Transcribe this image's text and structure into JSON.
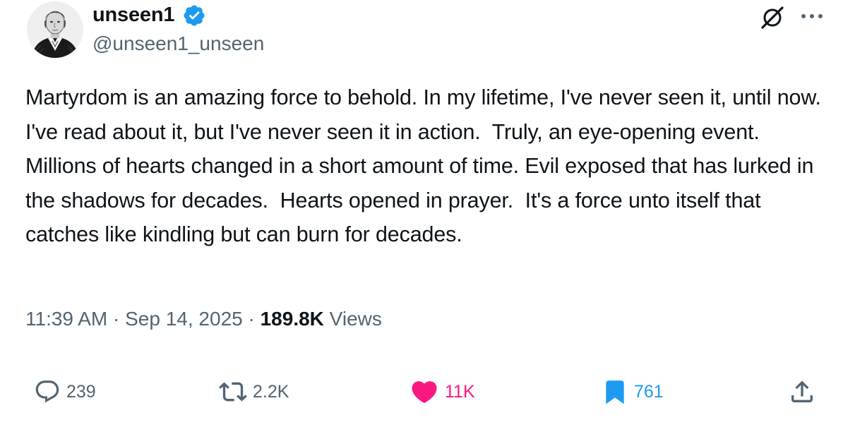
{
  "author": {
    "display_name": "unseen1",
    "handle": "@unseen1_unseen",
    "verified": true,
    "verified_color": "#1d9bf0",
    "avatar_icon": "portrait-engraving"
  },
  "header_actions": {
    "grok_icon": "grok-icon",
    "more_icon": "more-dots-icon"
  },
  "tweet": {
    "text": "Martyrdom is an amazing force to behold. In my lifetime, I've never seen it, until now.  I've read about it, but I've never seen it in action.  Truly, an eye-opening event. Millions of hearts changed in a short amount of time. Evil exposed that has lurked in the shadows for decades.  Hearts opened in prayer.  It's a force unto itself that catches like kindling but can burn for decades."
  },
  "meta": {
    "time": "11:39 AM",
    "separator": " · ",
    "date": "Sep 14, 2025",
    "views_count": "189.8K",
    "views_label": " Views"
  },
  "actions": {
    "reply_count": "239",
    "retweet_count": "2.2K",
    "like_count": "11K",
    "bookmark_count": "761",
    "like_active": true,
    "bookmark_active": true
  },
  "colors": {
    "text_primary": "#0f1419",
    "text_secondary": "#536471",
    "like": "#f91880",
    "bookmark": "#1d9bf0"
  }
}
